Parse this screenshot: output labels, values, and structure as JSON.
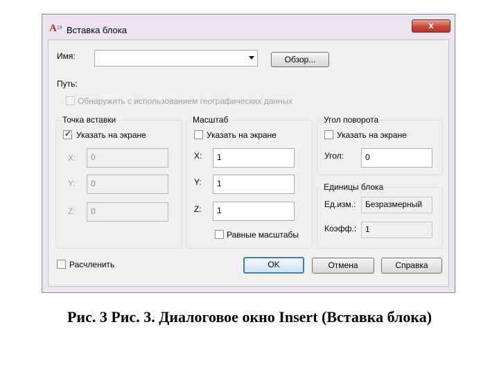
{
  "window": {
    "title": "Вставка блока",
    "close_label": "x"
  },
  "name": {
    "label": "Имя:",
    "value": ""
  },
  "browse_label": "Обзор...",
  "path_label": "Путь:",
  "geo_label": "Обнаружить с использованием географических данных",
  "insertion": {
    "group_label": "Точка вставки",
    "onscreen_label": "Указать на экране",
    "onscreen_checked": true,
    "x_label": "X:",
    "x_value": "0",
    "y_label": "Y:",
    "y_value": "0",
    "z_label": "Z:",
    "z_value": "0"
  },
  "scale": {
    "group_label": "Масштаб",
    "onscreen_label": "Указать на экране",
    "onscreen_checked": false,
    "x_label": "X:",
    "x_value": "1",
    "y_label": "Y:",
    "y_value": "1",
    "z_label": "Z:",
    "z_value": "1",
    "uniform_label": "Равные масштабы"
  },
  "rotation": {
    "group_label": "Угол поворота",
    "onscreen_label": "Указать на экране",
    "onscreen_checked": false,
    "angle_label": "Угол:",
    "angle_value": "0"
  },
  "units": {
    "group_label": "Единицы блока",
    "unit_label": "Ед.изм.:",
    "unit_value": "Безразмерный",
    "factor_label": "Коэфф.:",
    "factor_value": "1"
  },
  "explode_label": "Расчленить",
  "buttons": {
    "ok": "OK",
    "cancel": "Отмена",
    "help": "Справка"
  },
  "caption": "Рис. 3 Рис. 3. Диалоговое окно Insert (Вставка блока)"
}
